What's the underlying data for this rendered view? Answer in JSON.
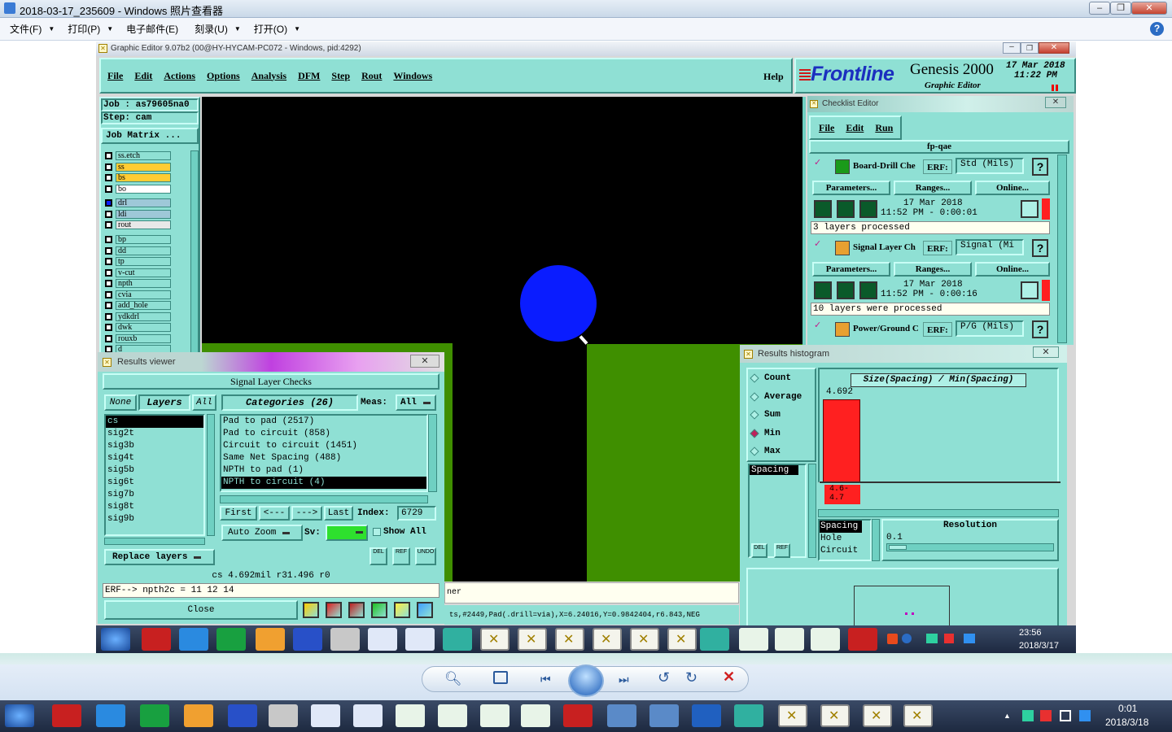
{
  "photo_viewer": {
    "title": "2018-03-17_235609 - Windows 照片查看器",
    "menu": [
      "文件(F)",
      "打印(P)",
      "电子邮件(E)",
      "刻录(U)",
      "打开(O)"
    ],
    "help_icon": "help-circle-icon"
  },
  "ge_window": {
    "title": "Graphic Editor 9.07b2 (00@HY-HYCAM-PC072 - Windows, pid:4292)",
    "menu": [
      "File",
      "Edit",
      "Actions",
      "Options",
      "Analysis",
      "DFM",
      "Step",
      "Rout",
      "Windows"
    ],
    "help": "Help",
    "brand": "Frontline",
    "product": "Genesis 2000",
    "product_sub": "Graphic Editor",
    "date": "17 Mar 2018",
    "time": "11:22 PM"
  },
  "job": {
    "job_label": "Job : as79605na0",
    "step_label": "Step: cam",
    "matrix_button": "Job Matrix ...",
    "layers_a": [
      "ss.etch",
      "ss",
      "bs",
      "bo"
    ],
    "layers_b": [
      "drl",
      "ldi",
      "rout"
    ],
    "layers_c": [
      "bp",
      "dd",
      "tp",
      "v-cut",
      "npth",
      "cvia",
      "add_hole",
      "ydkdrl",
      "dwk",
      "rouxb",
      "d"
    ]
  },
  "checklist": {
    "title": "Checklist Editor",
    "menu": [
      "File",
      "Edit",
      "Run"
    ],
    "name": "fp-qae",
    "items": [
      {
        "name": "Board-Drill Che",
        "erf": "ERF:",
        "erf_value": "Std (Mils)",
        "params": "Parameters...",
        "ranges": "Ranges...",
        "online": "Online...",
        "date": "17 Mar 2018",
        "time": "11:52 PM - 0:00:01",
        "status": "3 layers processed"
      },
      {
        "name": "Signal Layer Ch",
        "erf": "ERF:",
        "erf_value": "Signal (Mi",
        "params": "Parameters...",
        "ranges": "Ranges...",
        "online": "Online...",
        "date": "17 Mar 2018",
        "time": "11:52 PM - 0:00:16",
        "status": "10 layers were processed"
      },
      {
        "name": "Power/Ground C",
        "erf": "ERF:",
        "erf_value": "P/G (Mils)"
      }
    ]
  },
  "results_viewer": {
    "title": "Results viewer",
    "heading": "Signal Layer Checks",
    "none": "None",
    "layers": "Layers",
    "all": "All",
    "categories": "Categories (26)",
    "meas_label": "Meas:",
    "meas_value": "All",
    "layer_list": [
      "cs",
      "sig2t",
      "sig3b",
      "sig4t",
      "sig5b",
      "sig6t",
      "sig7b",
      "sig8t",
      "sig9b"
    ],
    "category_list": [
      "Pad to pad (2517)",
      "Pad to circuit (858)",
      "Circuit to circuit (1451)",
      "Same Net Spacing (488)",
      "NPTH to pad (1)",
      "NPTH to circuit (4)"
    ],
    "first": "First",
    "prev": "<---",
    "next": "--->",
    "last": "Last",
    "index_label": "Index:",
    "index_value": "6729",
    "auto_zoom": "Auto Zoom",
    "sv_label": "Sv:",
    "show_all": "Show All",
    "replace_layers": "Replace layers",
    "status": "cs 4.692mil   r31.496   r0",
    "erf_line": "ERF--> npth2c = 11 12 14",
    "close": "Close",
    "del": "DEL",
    "ref": "REF",
    "undo": "UNDO"
  },
  "histogram": {
    "title": "Results histogram",
    "modes": [
      "Count",
      "Average",
      "Sum",
      "Min",
      "Max"
    ],
    "selected_mode": "Min",
    "list_selected": "Spacing",
    "axis_title": "Size(Spacing) / Min(Spacing)",
    "bar_value": "4.692",
    "bin_label": "4.6-\n4.7",
    "sources": [
      "Spacing",
      "Hole",
      "Circuit"
    ],
    "resolution_label": "Resolution",
    "resolution_value": "0.1",
    "del": "DEL",
    "ref": "REF"
  },
  "ge_status": {
    "line1": "ner",
    "line2": "ts,#2449,Pad(.drill=via),X=6.24016,Y=0.9842404,r6.843,NEG"
  },
  "inner_clock": {
    "time": "23:56",
    "date": "2018/3/17"
  },
  "outer_clock": {
    "time": "0:01",
    "date": "2018/3/18"
  },
  "colors": {
    "teal": "#8fe0d4",
    "green": "#3f8f00",
    "blue": "#0a1cff",
    "red": "#ff2020"
  }
}
